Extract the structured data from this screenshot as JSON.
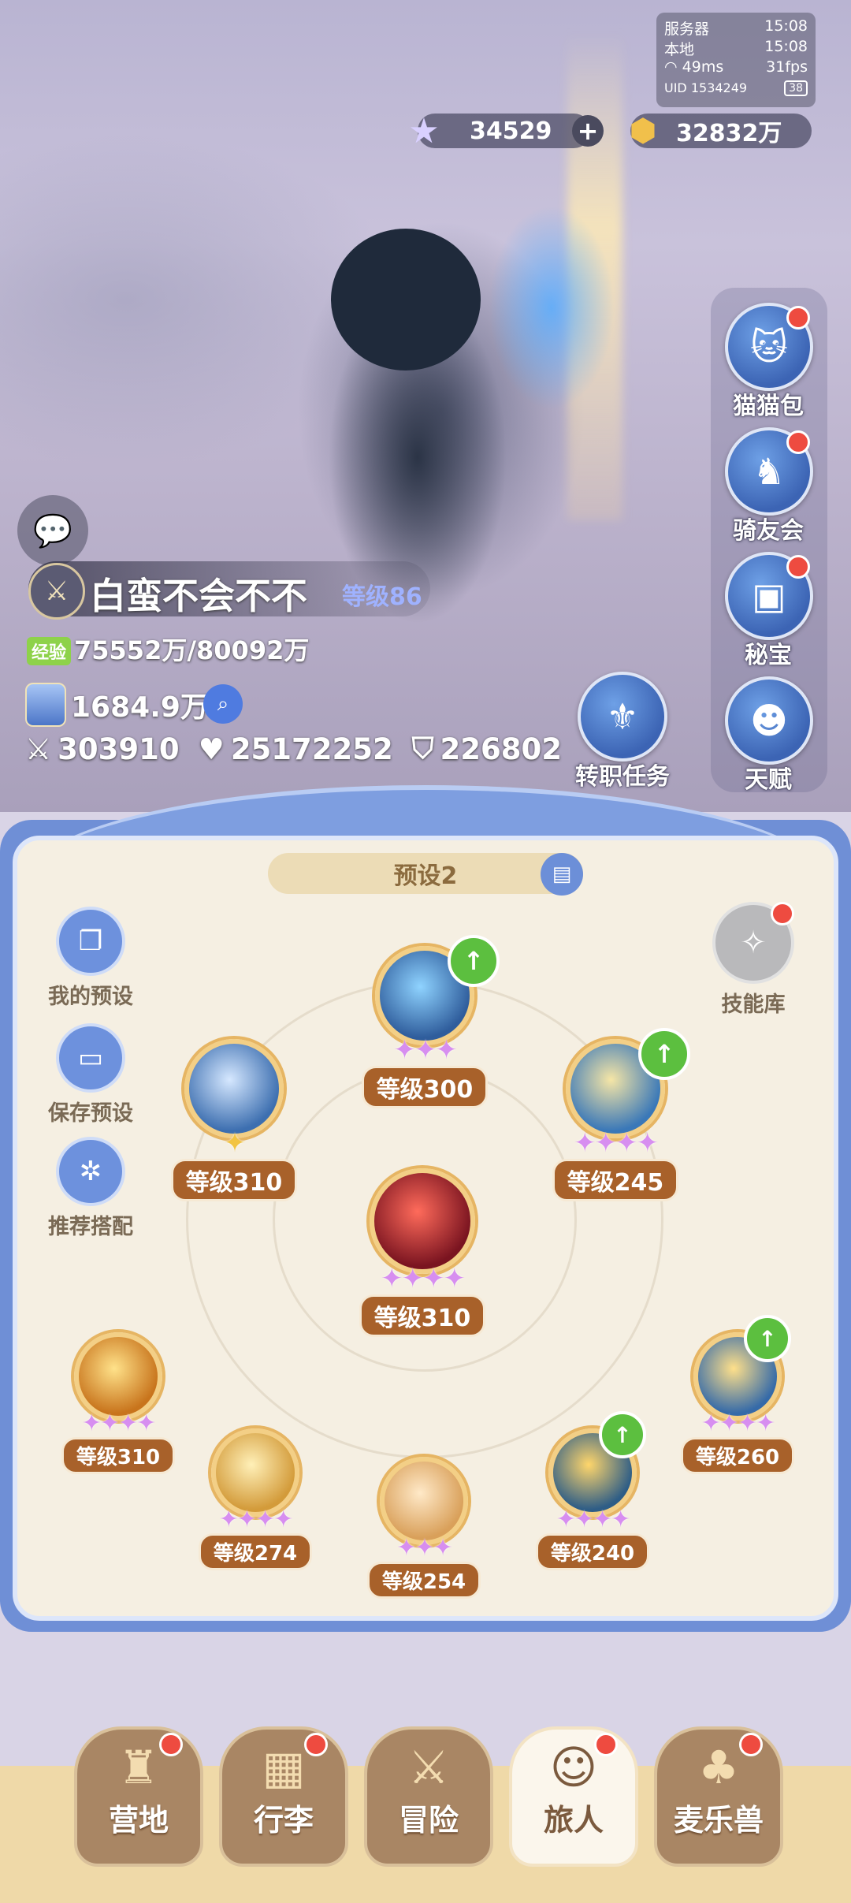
{
  "colors": {
    "accent_blue": "#6f8fd6",
    "level_badge": "#a8612a",
    "notify_red": "#ee4b40",
    "upgrade_green": "#5cbf3f"
  },
  "status": {
    "server_label": "服务器",
    "server_time": "15:08",
    "local_label": "本地",
    "local_time": "15:08",
    "ping": "49ms",
    "fps": "31fps",
    "uid": "UID 1534249",
    "battery": "38"
  },
  "currency": {
    "gems": "34529",
    "gold": "32832万"
  },
  "side_menu": [
    {
      "label": "猫猫包",
      "icon": "cat-bag-icon"
    },
    {
      "label": "骑友会",
      "icon": "horse-icon"
    },
    {
      "label": "秘宝",
      "icon": "treasure-chest-icon"
    },
    {
      "label": "天赋",
      "icon": "brain-head-icon"
    }
  ],
  "quest": {
    "label": "转职任务"
  },
  "player": {
    "name": "白蛮不会不不",
    "level": "等级86",
    "exp_tag": "经验",
    "exp": "75552万/80092万",
    "power": "1684.9万",
    "attack": "303910",
    "hp": "25172252",
    "defense": "226802"
  },
  "panel": {
    "preset_name": "预设2",
    "left_buttons": [
      {
        "label": "我的预设",
        "icon": "preset-cards-icon"
      },
      {
        "label": "保存预设",
        "icon": "save-disk-icon"
      },
      {
        "label": "推荐搭配",
        "icon": "recommend-icon"
      }
    ],
    "skill_library": "技能库"
  },
  "skills": [
    {
      "level": "等级300",
      "stars": "✦✦✦",
      "upgrade": true,
      "color": "#2f5d9c"
    },
    {
      "level": "等级310",
      "stars": "✦",
      "upgrade": false,
      "color": "#3d6fb0"
    },
    {
      "level": "等级245",
      "stars": "✦✦✦✦",
      "upgrade": true,
      "color": "#3a78b8"
    },
    {
      "level": "等级310",
      "stars": "✦✦✦✦",
      "upgrade": false,
      "color": "#7a1420"
    },
    {
      "level": "等级310",
      "stars": "✦✦✦✦",
      "upgrade": false,
      "color": "#c8741c"
    },
    {
      "level": "等级274",
      "stars": "✦✦✦✦",
      "upgrade": false,
      "color": "#d39b3a"
    },
    {
      "level": "等级254",
      "stars": "✦✦✦",
      "upgrade": false,
      "color": "#d9a05a"
    },
    {
      "level": "等级240",
      "stars": "✦✦✦✦",
      "upgrade": true,
      "color": "#2e5d86"
    },
    {
      "level": "等级260",
      "stars": "✦✦✦✦",
      "upgrade": true,
      "color": "#356aa8"
    }
  ],
  "tabs": [
    {
      "label": "营地",
      "icon": "castle-icon",
      "active": false
    },
    {
      "label": "行李",
      "icon": "luggage-icon",
      "active": false
    },
    {
      "label": "冒险",
      "icon": "crossed-swords-icon",
      "active": false
    },
    {
      "label": "旅人",
      "icon": "character-portrait-icon",
      "active": true
    },
    {
      "label": "麦乐兽",
      "icon": "creature-icon",
      "active": false
    }
  ]
}
